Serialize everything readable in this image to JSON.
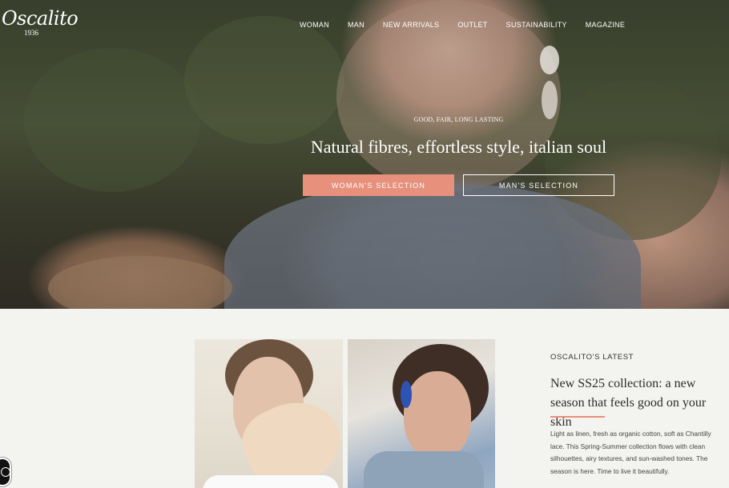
{
  "brand": {
    "logo_text": "Oscalito",
    "logo_year": "1936"
  },
  "nav": {
    "items": [
      "WOMAN",
      "MAN",
      "NEW ARRIVALS",
      "OUTLET",
      "SUSTAINABILITY",
      "MAGAZINE"
    ]
  },
  "hero": {
    "eyebrow": "GOOD, FAIR, LONG LASTING",
    "headline": "Natural fibres, effortless style, italian soul",
    "woman_button": "WOMAN'S SELECTION",
    "man_button": "MAN'S SELECTION"
  },
  "latest": {
    "label": "OSCALITO'S LATEST",
    "title": "New SS25 collection: a new season that feels good on your skin",
    "body": "Light as linen, fresh as organic cotton, soft as Chantilly lace. This Spring-Summer collection flows with clean silhouettes, airy textures, and sun-washed tones. The season is here. Time to live it beautifully."
  },
  "colors": {
    "accent": "#e7907c",
    "background": "#f3f3ef"
  },
  "icons": {
    "accessibility": "accessibility-icon"
  }
}
